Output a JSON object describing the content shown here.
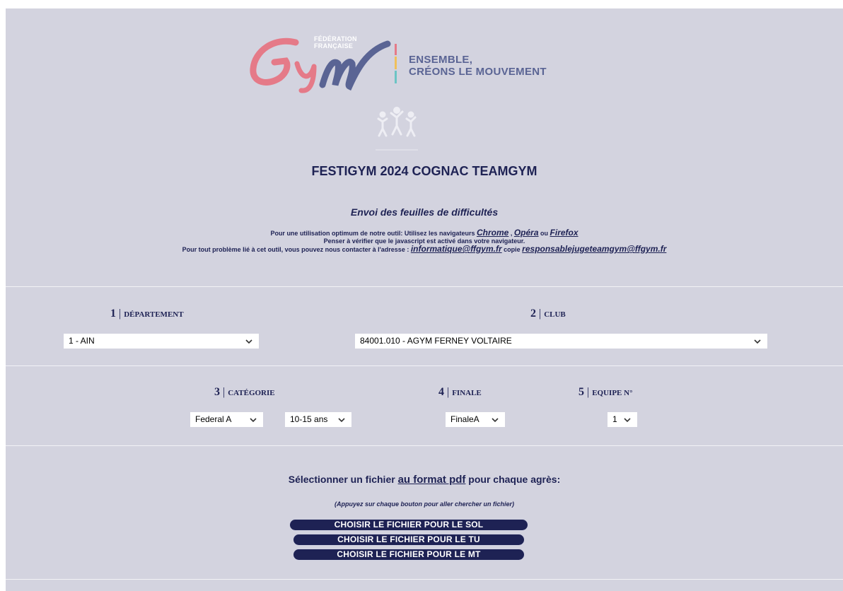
{
  "logo": {
    "small_line1": "FÉDÉRATION",
    "small_line2": "FRANÇAISE",
    "slogan_line1": "ENSEMBLE,",
    "slogan_line2": "CRÉONS LE MOUVEMENT"
  },
  "title": "FESTIGYM 2024 COGNAC TEAMGYM",
  "subtitle": "Envoi des feuilles de difficultés",
  "info": {
    "line1_prefix": "Pour une utilisation optimum de notre outil: Utilisez les navigateurs ",
    "browser_chrome": "Chrome",
    "sep_comma": " , ",
    "browser_opera": "Opéra",
    "sep_ou": " ou ",
    "browser_firefox": "Firefox",
    "line2": "Penser à vérifier que le javascript est activé dans votre navigateur.",
    "line3_prefix": "Pour tout problème lié à cet outil, vous pouvez nous contacter à l'adresse : ",
    "email_info": "informatique@ffgym.fr",
    "copie": " copie ",
    "email_juge": "responsablejugeteamgym@ffgym.fr"
  },
  "step1": {
    "num": "1",
    "bar": "|",
    "label": "Département",
    "value": "1 - AIN"
  },
  "step2": {
    "num": "2",
    "bar": "|",
    "label": "Club",
    "value": "84001.010 - AGYM FERNEY VOLTAIRE"
  },
  "step3": {
    "num": "3",
    "bar": "|",
    "label": "Catégorie",
    "value_level": "Federal A",
    "value_age": "10-15 ans"
  },
  "step4": {
    "num": "4",
    "bar": "|",
    "label": "Finale",
    "value": "FinaleA"
  },
  "step5": {
    "num": "5",
    "bar": "|",
    "label": "Equipe n°",
    "value": "1"
  },
  "files": {
    "prefix": "Sélectionner un fichier ",
    "format": "au format pdf",
    "suffix": " pour chaque agrès:",
    "hint": "(Appuyez sur chaque bouton pour aller chercher un fichier)",
    "btn_sol": "CHOISIR LE FICHIER POUR LE SOL",
    "btn_tu": "CHOISIR LE FICHIER POUR LE TU",
    "btn_mt": "CHOISIR LE FICHIER POUR LE MT"
  },
  "colors": {
    "background": "#d3d3df",
    "navy": "#1e2254",
    "logo_pink": "#e57a88",
    "logo_purple": "#5a6494"
  }
}
